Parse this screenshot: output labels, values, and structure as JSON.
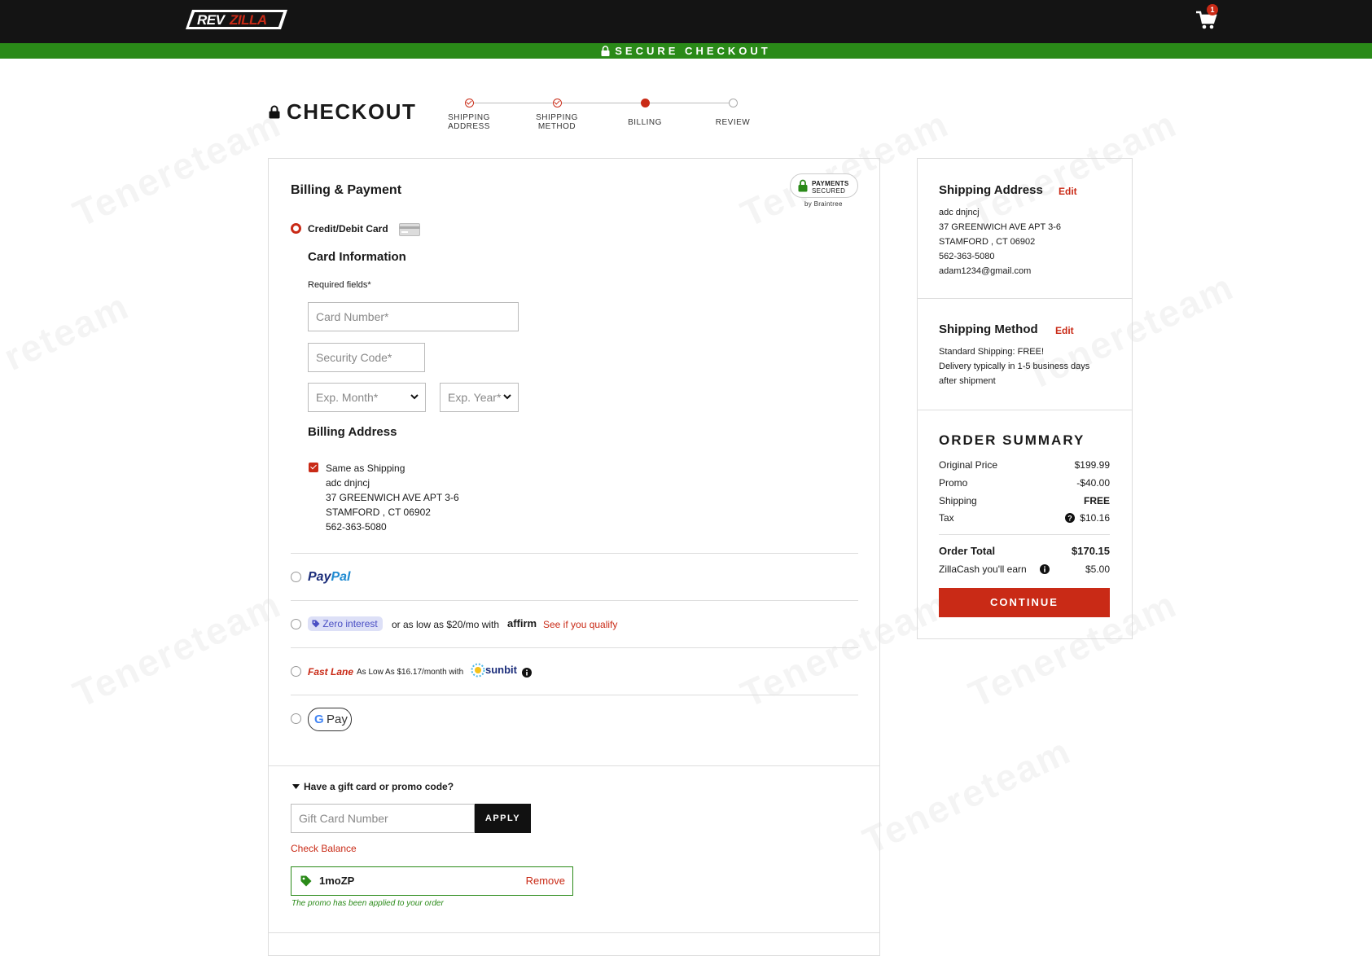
{
  "header": {
    "logo_text": "REVZILLA",
    "cart_count": "1",
    "secure_label": "SECURE CHECKOUT"
  },
  "checkout": {
    "title": "CHECKOUT",
    "steps": [
      {
        "label_line1": "SHIPPING",
        "label_line2": "ADDRESS",
        "state": "done"
      },
      {
        "label_line1": "SHIPPING",
        "label_line2": "METHOD",
        "state": "done"
      },
      {
        "label_line1": "BILLING",
        "label_line2": "",
        "state": "current"
      },
      {
        "label_line1": "REVIEW",
        "label_line2": "",
        "state": "todo"
      }
    ]
  },
  "billing": {
    "heading": "Billing & Payment",
    "badge_line1": "PAYMENTS",
    "badge_line2": "SECURED",
    "badge_by": "by Braintree",
    "card_option_label": "Credit/Debit Card",
    "card_info_heading": "Card Information",
    "required_note": "Required fields*",
    "card_number_placeholder": "Card Number*",
    "security_code_placeholder": "Security Code*",
    "exp_month_placeholder": "Exp. Month*",
    "exp_year_placeholder": "Exp. Year*",
    "billing_address_heading": "Billing Address",
    "same_as_shipping_label": "Same as Shipping",
    "address_lines": [
      "adc dnjncj",
      "37 GREENWICH AVE APT 3-6",
      "STAMFORD , CT 06902",
      "562-363-5080"
    ]
  },
  "payment_options": {
    "paypal_part1": "Pay",
    "paypal_part2": "Pal",
    "affirm_pill": "Zero interest",
    "affirm_text": "or as low as $20/mo with",
    "affirm_brand": "affirm",
    "affirm_link": "See if you qualify",
    "sunbit_fastlane": "Fast Lane",
    "sunbit_text": "As Low As $16.17/month with",
    "sunbit_brand": "sunbit",
    "gpay_label": "Pay"
  },
  "promo": {
    "toggle_label": "Have a gift card or promo code?",
    "gift_card_placeholder": "Gift Card Number",
    "apply_label": "APPLY",
    "check_balance_label": "Check Balance",
    "applied_code": "1moZP",
    "remove_label": "Remove",
    "applied_message": "The promo has been applied to your order"
  },
  "sidebar": {
    "shipping_address_heading": "Shipping Address",
    "edit_label": "Edit",
    "address_lines": [
      "adc dnjncj",
      "37 GREENWICH AVE APT 3-6",
      "STAMFORD , CT 06902",
      "562-363-5080",
      "adam1234@gmail.com"
    ],
    "shipping_method_heading": "Shipping Method",
    "method_lines": [
      "Standard Shipping: FREE!",
      "Delivery typically in 1-5 business days",
      "after shipment"
    ],
    "order_summary_heading": "ORDER SUMMARY",
    "summary_rows": [
      {
        "label": "Original Price",
        "value": "$199.99"
      },
      {
        "label": "Promo",
        "value": "-$40.00"
      },
      {
        "label": "Shipping",
        "value": "FREE"
      },
      {
        "label": "Tax",
        "value": "$10.16"
      }
    ],
    "order_total_label": "Order Total",
    "order_total_value": "$170.15",
    "zillacash_label": "ZillaCash you'll earn",
    "zillacash_value": "$5.00",
    "continue_label": "CONTINUE"
  },
  "colors": {
    "accent_red": "#c92a16",
    "secure_green": "#2a8a18",
    "header_black": "#141414"
  }
}
